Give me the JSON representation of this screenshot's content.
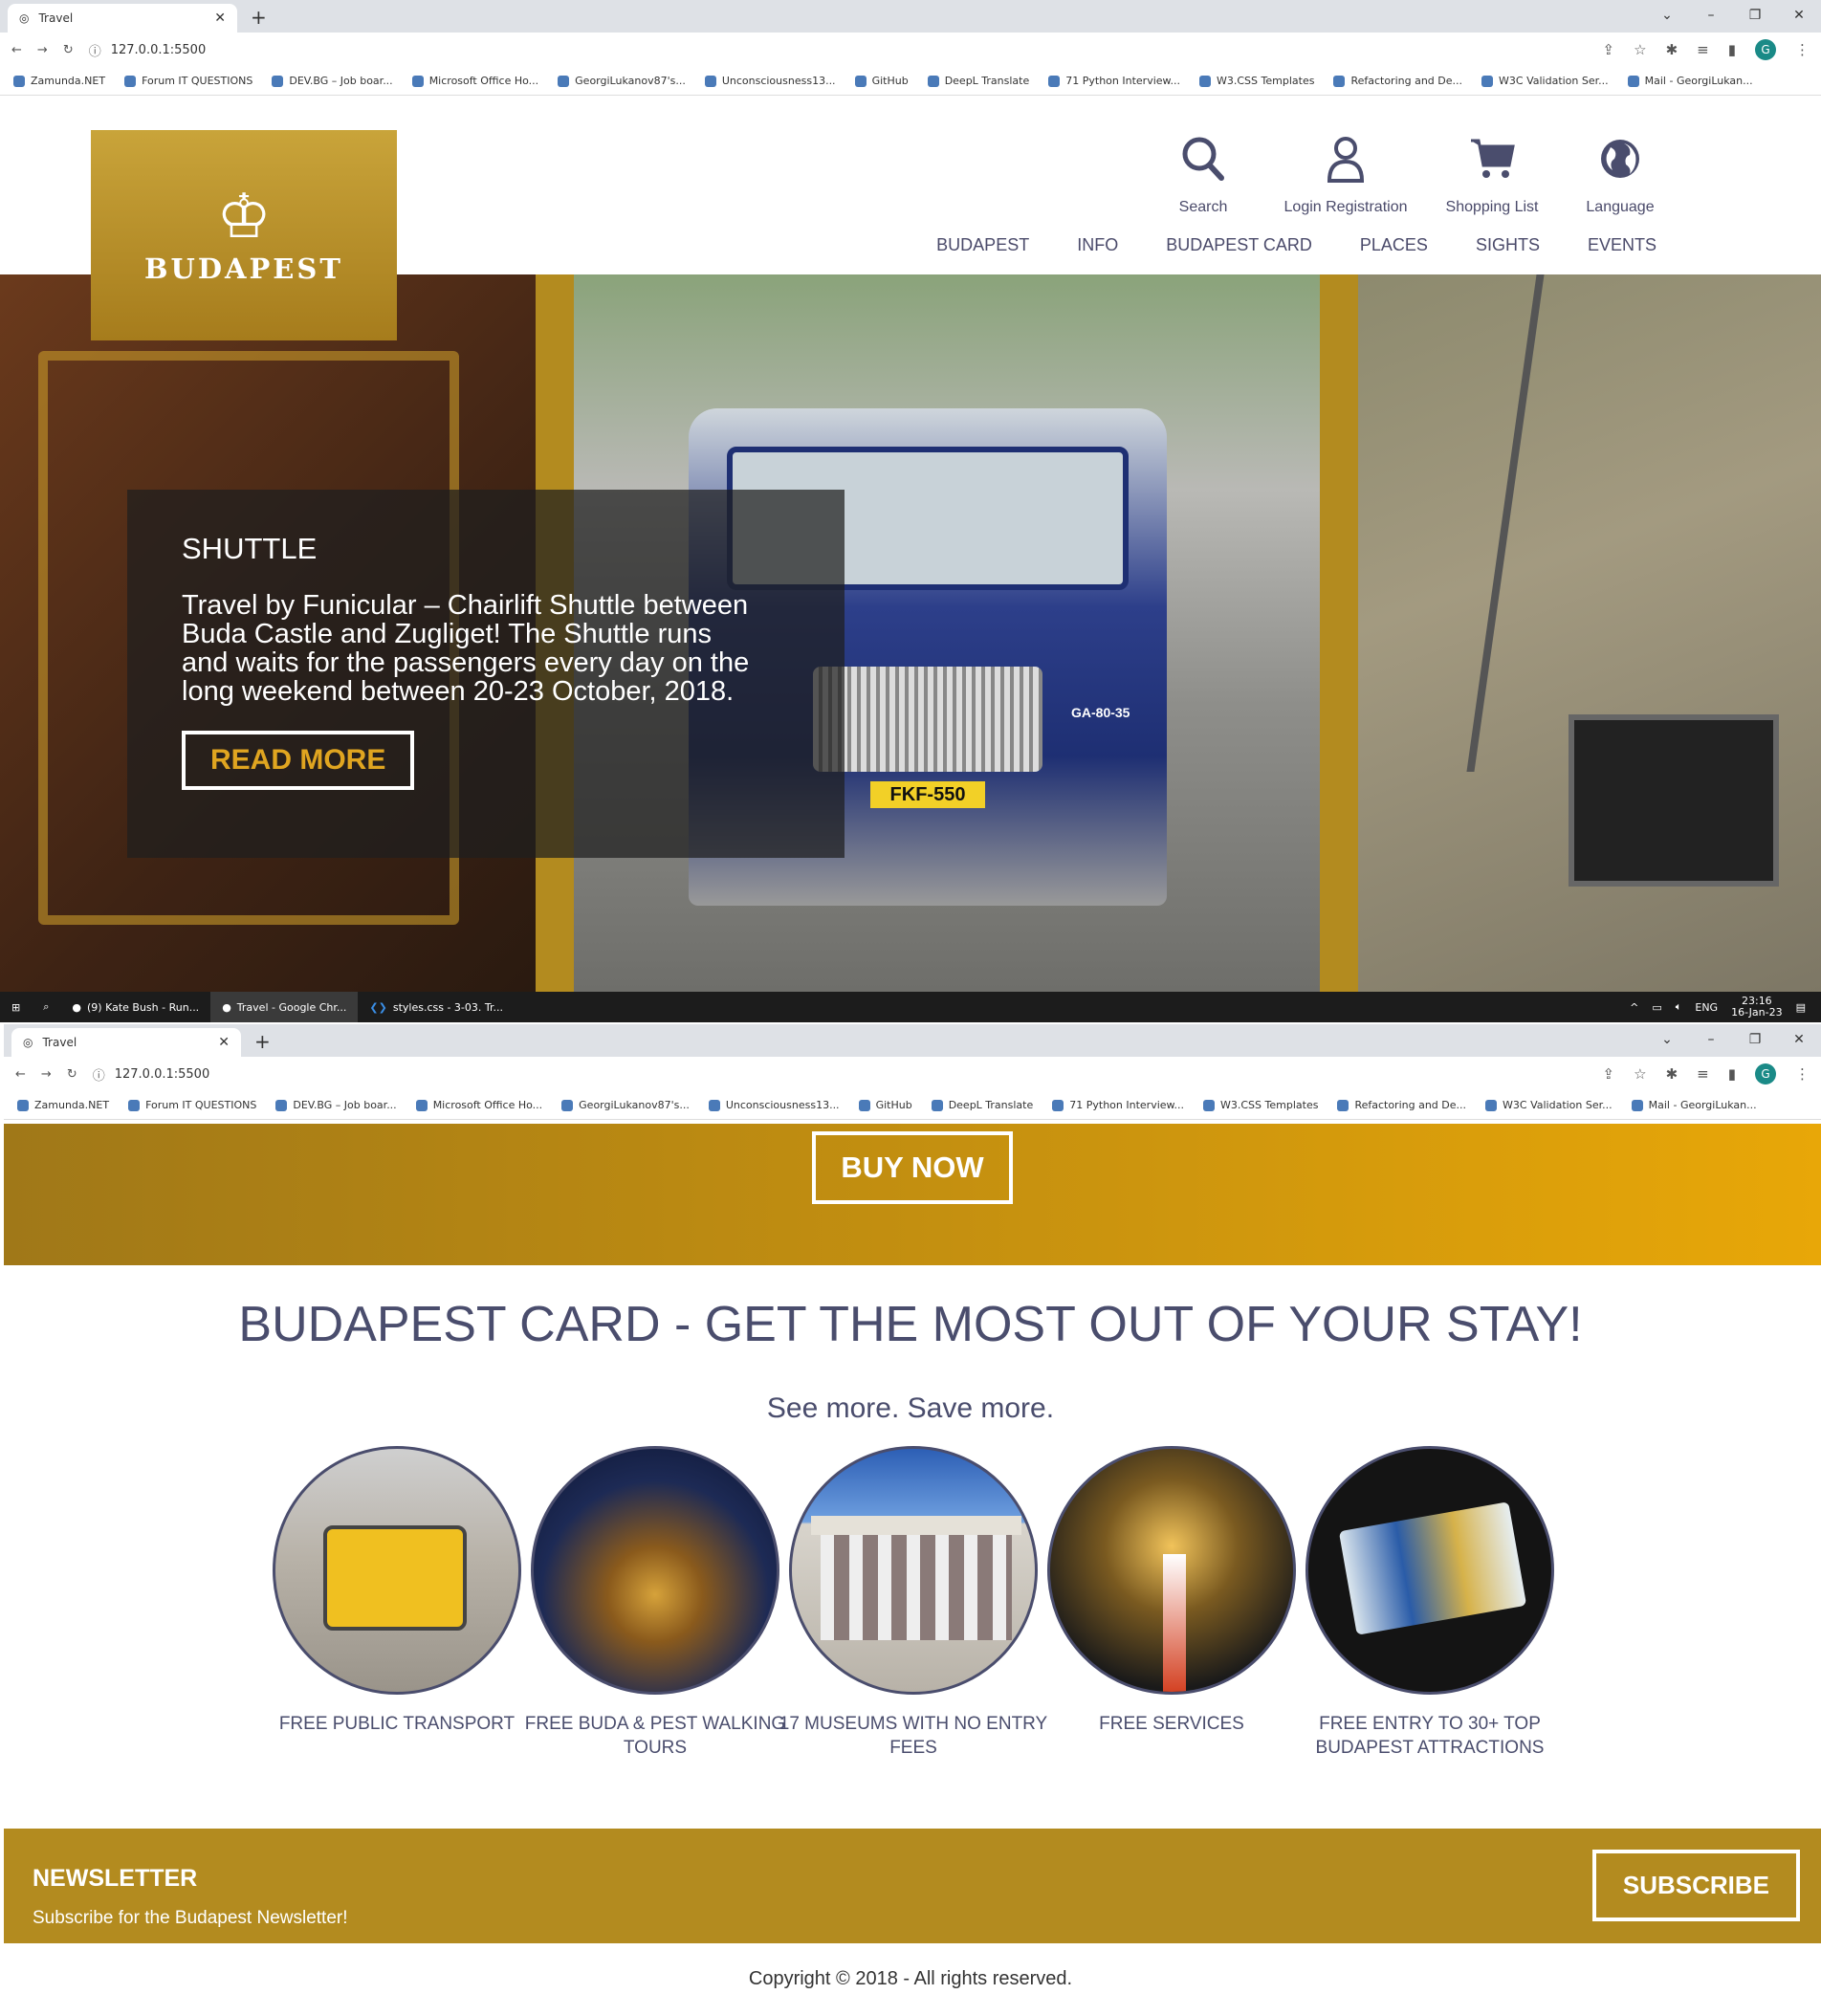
{
  "browser": {
    "tab_title": "Travel",
    "url": "127.0.0.1:5500",
    "bookmarks": [
      "Zamunda.NET",
      "Forum IT QUESTIONS",
      "DEV.BG – Job boar...",
      "Microsoft Office Ho...",
      "GeorgiLukanov87's...",
      "Unconsciousness13...",
      "GitHub",
      "DeepL Translate",
      "71 Python Interview...",
      "W3.CSS Templates",
      "Refactoring and De...",
      "W3C Validation Ser...",
      "Mail - GeorgiLukan..."
    ],
    "avatar_letter": "G"
  },
  "taskbar": {
    "items": [
      "(9) Kate Bush - Run...",
      "Travel - Google Chr...",
      "styles.css - 3-03. Tr..."
    ],
    "lang": "ENG",
    "time": "23:16",
    "date": "16-Jan-23"
  },
  "logo": {
    "text": "BUDAPEST"
  },
  "header_icons": [
    {
      "label": "Search",
      "icon": "search-icon"
    },
    {
      "label": "Login Registration",
      "icon": "user-icon"
    },
    {
      "label": "Shopping List",
      "icon": "cart-icon"
    },
    {
      "label": "Language",
      "icon": "globe-icon"
    }
  ],
  "nav": [
    "BUDAPEST",
    "INFO",
    "BUDAPEST CARD",
    "PLACES",
    "SIGHTS",
    "EVENTS"
  ],
  "hero": {
    "heading": "SHUTTLE",
    "text": "Travel by Funicular – Chairlift Shuttle between Buda Castle and Zugliget! The Shuttle runs and waits for the passengers every day on the long weekend between 20-23 October, 2018.",
    "button": "READ MORE",
    "bus_plate": "FKF-550",
    "bus_number": "GA-80-35"
  },
  "buy": {
    "button": "BUY NOW"
  },
  "card": {
    "title": "BUDAPEST CARD - GET THE MOST OUT OF YOUR STAY!",
    "subtitle": "See more. Save more.",
    "features": [
      {
        "caption": "FREE PUBLIC TRANSPORT"
      },
      {
        "caption": "FREE BUDA & PEST WALKING TOURS"
      },
      {
        "caption": "17 MUSEUMS WITH NO ENTRY FEES"
      },
      {
        "caption": "FREE SERVICES"
      },
      {
        "caption": "FREE ENTRY TO 30+ TOP BUDAPEST ATTRACTIONS"
      }
    ]
  },
  "newsletter": {
    "title": "NEWSLETTER",
    "text": "Subscribe for the Budapest Newsletter!",
    "button": "SUBSCRIBE"
  },
  "footer": {
    "copyright": "Copyright © 2018 - All rights reserved."
  },
  "colors": {
    "gold": "#b38b1f",
    "text": "#4a4d6d",
    "accent": "#e0a520"
  }
}
